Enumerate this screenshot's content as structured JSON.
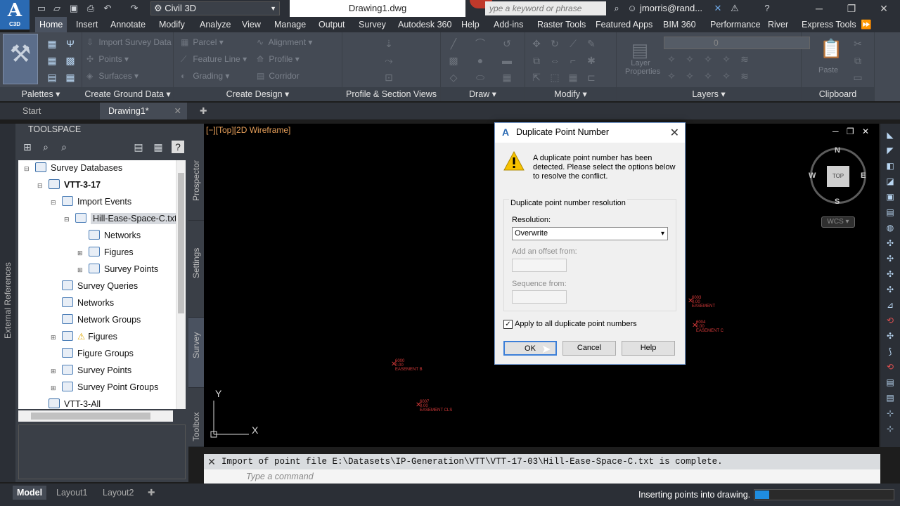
{
  "app": {
    "logo_big": "A",
    "logo_small": "C3D",
    "workspace": "Civil 3D",
    "file_title": "Drawing1.dwg",
    "search_placeholder": "ype a keyword or phrase",
    "user": "jmorris@rand...",
    "accent": "#2a6ab3"
  },
  "ribbon_tabs": [
    "Home",
    "Insert",
    "Annotate",
    "Modify",
    "Analyze",
    "View",
    "Manage",
    "Output",
    "Survey",
    "Autodesk 360",
    "Help",
    "Add-ins",
    "Raster Tools",
    "Featured Apps",
    "BIM 360",
    "Performance",
    "River",
    "Express Tools"
  ],
  "ribbon_panels": {
    "palettes": "Palettes",
    "create_ground_data": "Create Ground Data",
    "create_design": "Create Design",
    "profile_section": "Profile & Section Views",
    "draw": "Draw",
    "modify": "Modify",
    "layers": "Layers",
    "clipboard": "Clipboard"
  },
  "ribbon_items": {
    "import_survey_data": "Import Survey Data",
    "points": "Points",
    "surfaces": "Surfaces",
    "parcel": "Parcel",
    "feature_line": "Feature Line",
    "grading": "Grading",
    "alignment": "Alignment",
    "profile": "Profile",
    "corridor": "Corridor",
    "layer_properties": "Layer Properties",
    "paste": "Paste",
    "layer_value": "0"
  },
  "file_tabs": {
    "start": "Start",
    "drawing": "Drawing1*"
  },
  "toolspace": {
    "title": "TOOLSPACE",
    "side_label": "External References",
    "vertical_tabs": [
      "Prospector",
      "Settings",
      "Survey",
      "Toolbox"
    ],
    "tree": [
      {
        "label": "Survey Databases",
        "depth": 0,
        "exp": "⊟"
      },
      {
        "label": "VTT-3-17",
        "depth": 1,
        "exp": "⊟",
        "bold": true
      },
      {
        "label": "Import Events",
        "depth": 2,
        "exp": "⊟"
      },
      {
        "label": "Hill-Ease-Space-C.txt",
        "depth": 3,
        "exp": "⊟",
        "selected": true
      },
      {
        "label": "Networks",
        "depth": 4,
        "exp": ""
      },
      {
        "label": "Figures",
        "depth": 4,
        "exp": "⊞"
      },
      {
        "label": "Survey Points",
        "depth": 4,
        "exp": "⊞"
      },
      {
        "label": "Survey Queries",
        "depth": 2,
        "exp": ""
      },
      {
        "label": "Networks",
        "depth": 2,
        "exp": ""
      },
      {
        "label": "Network Groups",
        "depth": 2,
        "exp": ""
      },
      {
        "label": "Figures",
        "depth": 2,
        "exp": "⊞",
        "warn": true
      },
      {
        "label": "Figure Groups",
        "depth": 2,
        "exp": ""
      },
      {
        "label": "Survey Points",
        "depth": 2,
        "exp": "⊞"
      },
      {
        "label": "Survey Point Groups",
        "depth": 2,
        "exp": "⊞"
      },
      {
        "label": "VTT-3-All",
        "depth": 1,
        "exp": ""
      }
    ]
  },
  "viewport": {
    "label": "[−][Top][2D Wireframe]",
    "compass": {
      "n": "N",
      "s": "S",
      "e": "E",
      "w": "W",
      "top": "TOP"
    },
    "wcs": "WCS",
    "axis_x": "X",
    "axis_y": "Y",
    "points": [
      {
        "num": "6003",
        "elev": "0.00",
        "desc": "EASEMENT"
      },
      {
        "num": "6004",
        "elev": "0.00",
        "desc": "EASEMENT C"
      },
      {
        "num": "6000",
        "elev": "0.00",
        "desc": "EASEMENT B"
      },
      {
        "num": "6007",
        "elev": "0.00",
        "desc": "EASEMENT CLS"
      }
    ]
  },
  "dialog": {
    "title": "Duplicate Point Number",
    "message": "A duplicate point number has been detected.  Please select the options below to resolve the conflict.",
    "group_label": "Duplicate point number resolution",
    "resolution_label": "Resolution:",
    "resolution_value": "Overwrite",
    "offset_label": "Add an offset from:",
    "sequence_label": "Sequence from:",
    "apply_all_label": "Apply to all duplicate point numbers",
    "apply_all_checked": true,
    "ok": "OK",
    "cancel": "Cancel",
    "help": "Help"
  },
  "command": {
    "history": "Import of point file E:\\Datasets\\IP-Generation\\VTT\\VTT-17-03\\Hill-Ease-Space-C.txt is complete.",
    "placeholder": "Type a command"
  },
  "status": {
    "tabs": [
      "Model",
      "Layout1",
      "Layout2"
    ],
    "message": "Inserting points into drawing.",
    "progress": 0.1
  }
}
